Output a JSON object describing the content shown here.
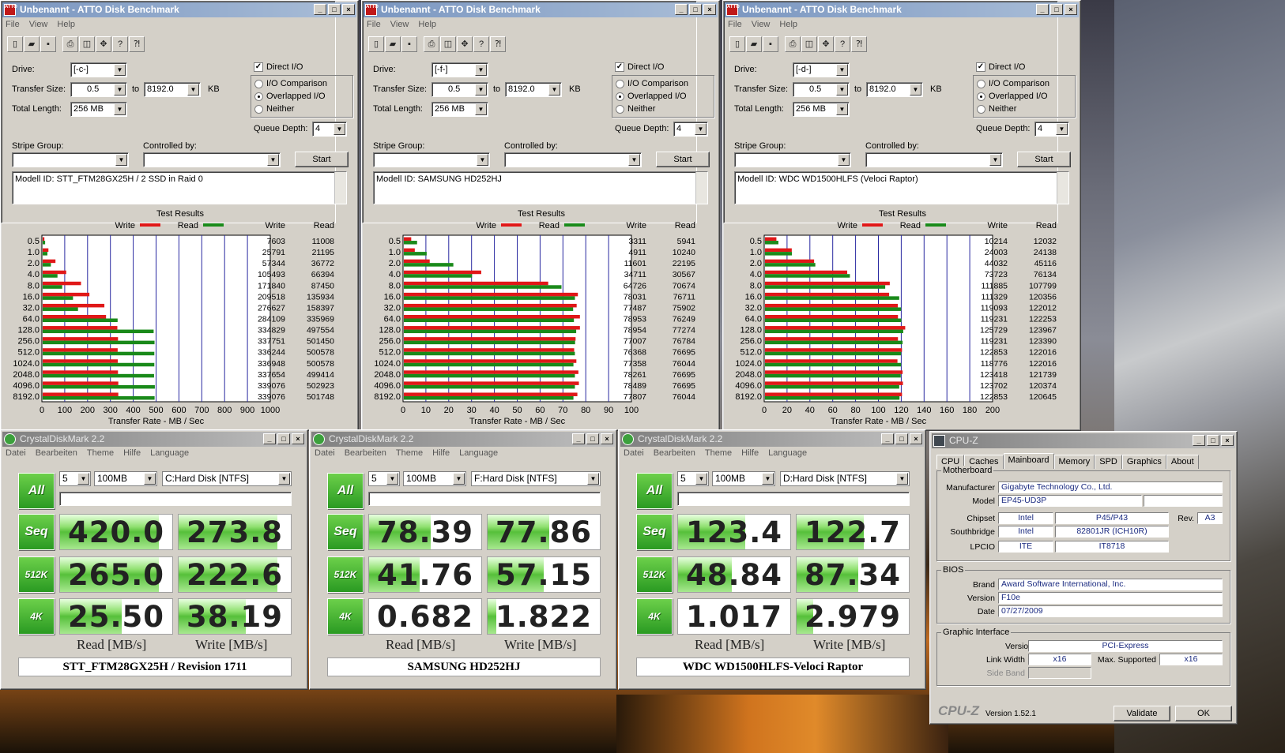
{
  "atto": {
    "title": "Unbenannt - ATTO Disk Benchmark",
    "menu": [
      "File",
      "View",
      "Help"
    ],
    "labels": {
      "drive": "Drive:",
      "transfer_size": "Transfer Size:",
      "to": "to",
      "kb": "KB",
      "total_length": "Total Length:",
      "direct_io": "Direct I/O",
      "io_comparison": "I/O Comparison",
      "overlapped_io": "Overlapped I/O",
      "neither": "Neither",
      "queue_depth": "Queue Depth:",
      "stripe_group": "Stripe Group:",
      "controlled_by": "Controlled by:",
      "start": "Start",
      "test_results": "Test Results",
      "write": "Write",
      "read": "Read",
      "xlabel": "Transfer Rate - MB / Sec"
    },
    "transfer_from": "0.5",
    "transfer_to": "8192.0",
    "total_length": "256 MB",
    "queue_depth": "4",
    "sizes": [
      "0.5",
      "1.0",
      "2.0",
      "4.0",
      "8.0",
      "16.0",
      "32.0",
      "64.0",
      "128.0",
      "256.0",
      "512.0",
      "1024.0",
      "2048.0",
      "4096.0",
      "8192.0"
    ],
    "colors": {
      "write": "#e01818",
      "read": "#1a8a1a",
      "grid": "#2828a0"
    },
    "windows": [
      {
        "drive": "[-c-]",
        "modell": "Modell ID: STT_FTM28GX25H / 2 SSD in Raid 0",
        "xmax": 1000,
        "xticks": [
          0,
          100,
          200,
          300,
          400,
          500,
          600,
          700,
          800,
          900,
          1000
        ],
        "write": [
          7603,
          25791,
          57344,
          105493,
          171840,
          209518,
          276627,
          284109,
          334829,
          337751,
          336244,
          336948,
          337654,
          339076,
          339076
        ],
        "read": [
          11008,
          21195,
          36772,
          66394,
          87450,
          135934,
          158397,
          335969,
          497554,
          501450,
          500578,
          500578,
          499414,
          502923,
          501748
        ]
      },
      {
        "drive": "[-f-]",
        "modell": "Modell ID: SAMSUNG HD252HJ",
        "xmax": 100,
        "xticks": [
          0,
          10,
          20,
          30,
          40,
          50,
          60,
          70,
          80,
          90,
          100
        ],
        "write": [
          3311,
          4911,
          11601,
          34711,
          64726,
          78031,
          77487,
          78953,
          78954,
          77007,
          76368,
          77358,
          78261,
          78489,
          77807
        ],
        "read": [
          5941,
          10240,
          22195,
          30567,
          70674,
          76711,
          75902,
          76249,
          77274,
          76784,
          76695,
          76044,
          76695,
          76695,
          76044
        ]
      },
      {
        "drive": "[-d-]",
        "modell": "Modell ID: WDC WD1500HLFS (Veloci Raptor)",
        "xmax": 200,
        "xticks": [
          0,
          20,
          40,
          60,
          80,
          100,
          120,
          140,
          160,
          180,
          200
        ],
        "write": [
          10214,
          24003,
          44032,
          73723,
          111885,
          111329,
          119093,
          119231,
          125729,
          119231,
          122853,
          118776,
          123418,
          123702,
          122853
        ],
        "read": [
          12032,
          24138,
          45116,
          76134,
          107799,
          120356,
          122012,
          122253,
          123967,
          123390,
          122016,
          122016,
          121739,
          120374,
          120645
        ]
      }
    ]
  },
  "cdm": {
    "title": "CrystalDiskMark 2.2",
    "menu": [
      "Datei",
      "Bearbeiten",
      "Theme",
      "Hilfe",
      "Language"
    ],
    "all_label": "All",
    "runs": "5",
    "size": "100MB",
    "row_labels": [
      "Seq",
      "512K",
      "4K"
    ],
    "read_header": "Read [MB/s]",
    "write_header": "Write [MB/s]",
    "windows": [
      {
        "drive": "C:Hard Disk [NTFS]",
        "model": "STT_FTM28GX25H / Revision 1711",
        "read": [
          "420.0",
          "265.0",
          "25.50"
        ],
        "write": [
          "273.8",
          "222.6",
          "38.19"
        ],
        "read_fill": [
          0.88,
          0.88,
          0.55
        ],
        "write_fill": [
          0.88,
          0.88,
          0.6
        ]
      },
      {
        "drive": "F:Hard Disk [NTFS]",
        "model": "SAMSUNG HD252HJ",
        "read": [
          "78.39",
          "41.76",
          "0.682"
        ],
        "write": [
          "77.86",
          "57.15",
          "1.822"
        ],
        "read_fill": [
          0.55,
          0.45,
          0.0
        ],
        "write_fill": [
          0.55,
          0.5,
          0.08
        ]
      },
      {
        "drive": "D:Hard Disk [NTFS]",
        "model": "WDC WD1500HLFS-Veloci Raptor",
        "read": [
          "123.4",
          "48.84",
          "1.017"
        ],
        "write": [
          "122.7",
          "87.34",
          "2.979"
        ],
        "read_fill": [
          0.6,
          0.48,
          0.0
        ],
        "write_fill": [
          0.6,
          0.55,
          0.15
        ]
      }
    ]
  },
  "cpuz": {
    "title": "CPU-Z",
    "tabs": [
      "CPU",
      "Caches",
      "Mainboard",
      "Memory",
      "SPD",
      "Graphics",
      "About"
    ],
    "active_tab": "Mainboard",
    "motherboard": {
      "legend": "Motherboard",
      "manufacturer_label": "Manufacturer",
      "manufacturer": "Gigabyte Technology Co., Ltd.",
      "model_label": "Model",
      "model": "EP45-UD3P",
      "chipset_label": "Chipset",
      "chipset_vendor": "Intel",
      "chipset": "P45/P43",
      "rev_label": "Rev.",
      "rev": "A3",
      "southbridge_label": "Southbridge",
      "southbridge_vendor": "Intel",
      "southbridge": "82801JR (ICH10R)",
      "lpcio_label": "LPCIO",
      "lpcio_vendor": "ITE",
      "lpcio": "IT8718"
    },
    "bios": {
      "legend": "BIOS",
      "brand_label": "Brand",
      "brand": "Award Software International, Inc.",
      "version_label": "Version",
      "version": "F10e",
      "date_label": "Date",
      "date": "07/27/2009"
    },
    "graphic": {
      "legend": "Graphic Interface",
      "version_label": "Version",
      "version": "PCI-Express",
      "link_width_label": "Link Width",
      "link_width": "x16",
      "max_supported_label": "Max. Supported",
      "max_supported": "x16",
      "side_band_label": "Side Band"
    },
    "footer": {
      "logo": "CPU-Z",
      "version": "Version 1.52.1",
      "validate": "Validate",
      "ok": "OK"
    }
  }
}
